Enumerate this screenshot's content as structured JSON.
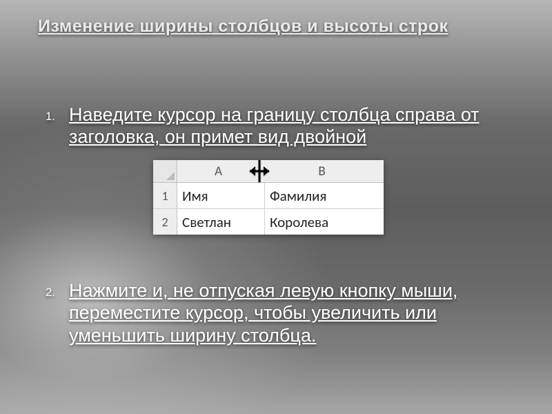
{
  "title": "Изменение ширины столбцов и высоты строк",
  "list": {
    "num1": "1.",
    "num2": "2.",
    "para1": "Наведите курсор на границу столбца справа от заголовка, он примет вид двойной",
    "para2": "Нажмите и, не отпуская левую кнопку мыши, переместите курсор, чтобы увеличить или уменьшить ширину столбца."
  },
  "sheet": {
    "cols": {
      "A": "A",
      "B": "B"
    },
    "rows": {
      "r1": "1",
      "r2": "2"
    },
    "cells": {
      "a1": "Имя",
      "b1": "Фамилия",
      "a2": "Светлан",
      "b2": "Королева"
    }
  }
}
